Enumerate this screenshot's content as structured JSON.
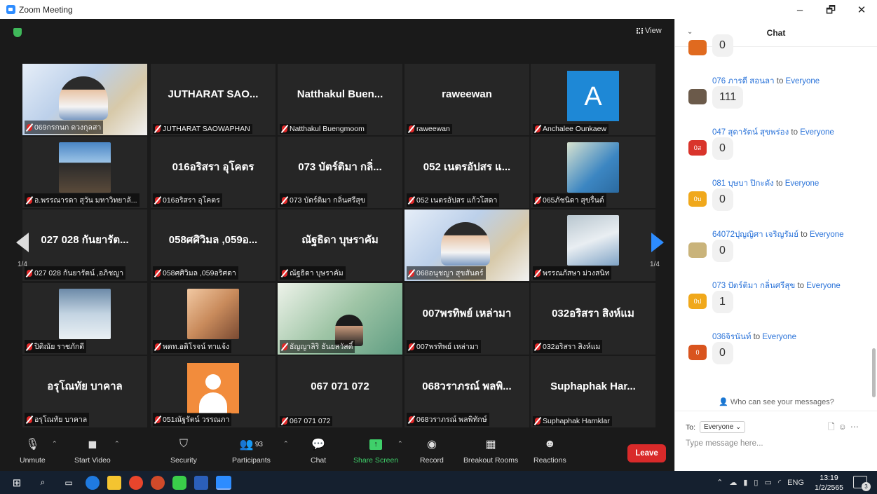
{
  "window": {
    "title": "Zoom Meeting",
    "minimize": "–",
    "maximize": "🗗",
    "close": "✕"
  },
  "video": {
    "view_label": "View",
    "page_indicator_left": "1/4",
    "page_indicator_right": "1/4",
    "tiles": [
      {
        "type": "poster",
        "label": "069กรกนก ดวงกุลสา"
      },
      {
        "type": "name",
        "name": "JUTHARAT SAO...",
        "label": "JUTHARAT SAOWAPHAN"
      },
      {
        "type": "name",
        "name": "Natthakul Buen...",
        "label": "Natthakul Buengmoom"
      },
      {
        "type": "name",
        "name": "raweewan",
        "label": "raweewan"
      },
      {
        "type": "avatar",
        "initial": "A",
        "label": "Anchalee Ounkaew"
      },
      {
        "type": "photo",
        "photo": "p1",
        "label": "อ.พรรณารดา สุวัน มหาวิทยาลั..."
      },
      {
        "type": "name",
        "name": "016อริสรา อุโคตร",
        "label": "016อริสรา อุโคตร"
      },
      {
        "type": "name",
        "name": "073 บัตร์ติมา กลิ่...",
        "label": "073 บัตร์ติมา กลิ่นศรีสุข"
      },
      {
        "type": "name",
        "name": "052 เนตรอัปสร แ...",
        "label": "052 เนตรอัปสร แก้วโสดา"
      },
      {
        "type": "photo",
        "photo": "p2",
        "label": "065ภัชนิดา สุขรื่นต์"
      },
      {
        "type": "name",
        "name": "027 028 กันยารัต...",
        "label": "027 028 กันยารัตน์ ,อภิชญา"
      },
      {
        "type": "name",
        "name": "058ศศิวิมล ,059อ...",
        "label": "058ศศิวิมล ,059อริศดา"
      },
      {
        "type": "name",
        "name": "ณัฐธิดา บุษราคัม",
        "label": "ณัฐธิดา บุษราคัม"
      },
      {
        "type": "poster",
        "label": "068อนุชญา สุขสันตร์"
      },
      {
        "type": "photo",
        "photo": "p3",
        "label": "พรรณภัสษา ม่วงสนิท"
      },
      {
        "type": "photo",
        "photo": "p4",
        "label": "ปิติณัย ราชภักดี"
      },
      {
        "type": "photo",
        "photo": "p5",
        "label": "พตท.อติโรจน์ ทาแจ้ง"
      },
      {
        "type": "poster2",
        "label": "ธัญญาลิริ ธันยสวัสดิ์"
      },
      {
        "type": "name",
        "name": "007พรทิพย์ เหล่ามา",
        "label": "007พรทิพย์ เหล่ามา"
      },
      {
        "type": "name",
        "name": "032อริสรา สิงห์แม",
        "label": "032อริสรา สิงห์แม"
      },
      {
        "type": "name",
        "name": "อรุโณทัย บาคาล",
        "label": "อรุโณทัย บาคาล"
      },
      {
        "type": "default",
        "label": "051ณัฐรัตน์ วรรณภา"
      },
      {
        "type": "name",
        "name": "067 071 072",
        "label": "067 071 072"
      },
      {
        "type": "name",
        "name": "068วราภรณ์ พลพิ...",
        "label": "068วราภรณ์ พลพิทักษ์"
      },
      {
        "type": "name",
        "name": "Suphaphak Har...",
        "label": "Suphaphak Harnklar"
      }
    ]
  },
  "toolbar": {
    "unmute": "Unmute",
    "start_video": "Start Video",
    "security": "Security",
    "participants": "Participants",
    "participants_count": "93",
    "chat": "Chat",
    "share_screen": "Share Screen",
    "record": "Record",
    "breakout_rooms": "Breakout Rooms",
    "reactions": "Reactions",
    "leave": "Leave"
  },
  "chat": {
    "title": "Chat",
    "messages": [
      {
        "from": "",
        "to": "",
        "avatar": "",
        "avatar_color": "#e06a1f",
        "text": "0"
      },
      {
        "from": "076 ภารดี สอนลา",
        "to": "Everyone",
        "avatar": "",
        "avatar_color": "#6b5a4a",
        "text": "111"
      },
      {
        "from": "047 สุดารัตน์ สุขพร่อง",
        "to": "Everyone",
        "avatar": "0ส",
        "avatar_color": "#d9342b",
        "text": "0"
      },
      {
        "from": "081 บุษบา ปิกะตัง",
        "to": "Everyone",
        "avatar": "0บ",
        "avatar_color": "#f0a81b",
        "text": "0"
      },
      {
        "from": "64072ปุญญิศา เจริญรัมย์",
        "to": "Everyone",
        "avatar": "",
        "avatar_color": "#c9b37a",
        "text": "0"
      },
      {
        "from": "073 ปัตร์ติมา กลิ่นศรีสุข",
        "to": "Everyone",
        "avatar": "0ป",
        "avatar_color": "#f0a81b",
        "text": "1"
      },
      {
        "from": "036จิรนันท์",
        "to": "Everyone",
        "avatar": "0",
        "avatar_color": "#d9541e",
        "text": "0"
      }
    ],
    "to_word": " to ",
    "who_can_see": "Who can see your messages?",
    "to_label": "To:",
    "to_value": "Everyone ⌄",
    "placeholder": "Type message here..."
  },
  "taskbar": {
    "tray_lang": "ENG",
    "time": "13:19",
    "date": "1/2/2565",
    "notifications": "3"
  }
}
